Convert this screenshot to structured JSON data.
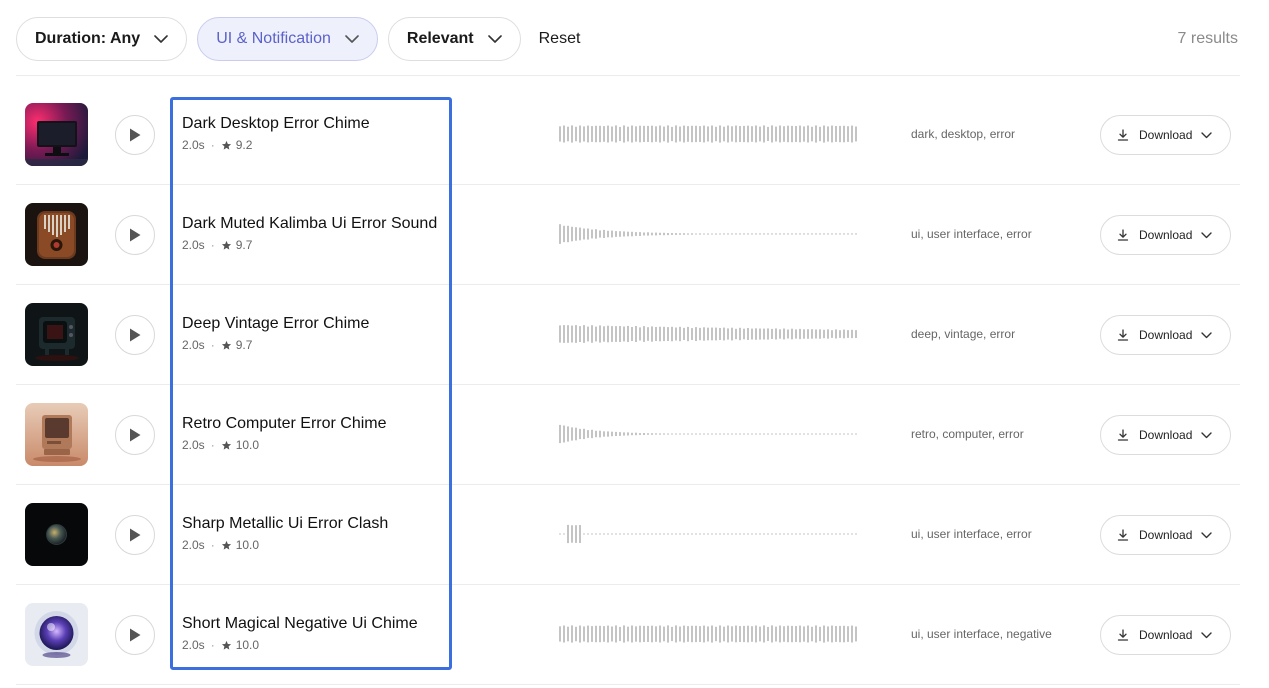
{
  "filters": {
    "duration_label": "Duration: Any",
    "category_label": "UI & Notification",
    "sort_label": "Relevant",
    "reset_label": "Reset",
    "results_count": "7 results"
  },
  "colors": {
    "accent": "#5b62c9",
    "highlight_border": "#3b6fe0",
    "waveform": "#c4c4c4"
  },
  "download_label": "Download",
  "sounds": [
    {
      "title": "Dark Desktop Error Chime",
      "duration": "2.0s",
      "rating": "9.2",
      "tags": "dark, desktop, error",
      "thumbnail": "neon-monitor-icon",
      "waveform_profile": "sustained"
    },
    {
      "title": "Dark Muted Kalimba Ui Error Sound",
      "duration": "2.0s",
      "rating": "9.7",
      "tags": "ui, user interface, error",
      "thumbnail": "kalimba-icon",
      "waveform_profile": "decay"
    },
    {
      "title": "Deep Vintage Error Chime",
      "duration": "2.0s",
      "rating": "9.7",
      "tags": "deep, vintage, error",
      "thumbnail": "vintage-tv-icon",
      "waveform_profile": "slow-decay"
    },
    {
      "title": "Retro Computer Error Chime",
      "duration": "2.0s",
      "rating": "10.0",
      "tags": "retro, computer, error",
      "thumbnail": "retro-computer-icon",
      "waveform_profile": "fast-decay"
    },
    {
      "title": "Sharp Metallic Ui Error Clash",
      "duration": "2.0s",
      "rating": "10.0",
      "tags": "ui, user interface, error",
      "thumbnail": "metallic-sphere-icon",
      "waveform_profile": "burst"
    },
    {
      "title": "Short Magical Negative Ui Chime",
      "duration": "2.0s",
      "rating": "10.0",
      "tags": "ui, user interface, negative",
      "thumbnail": "magic-orb-icon",
      "waveform_profile": "sustained"
    }
  ]
}
